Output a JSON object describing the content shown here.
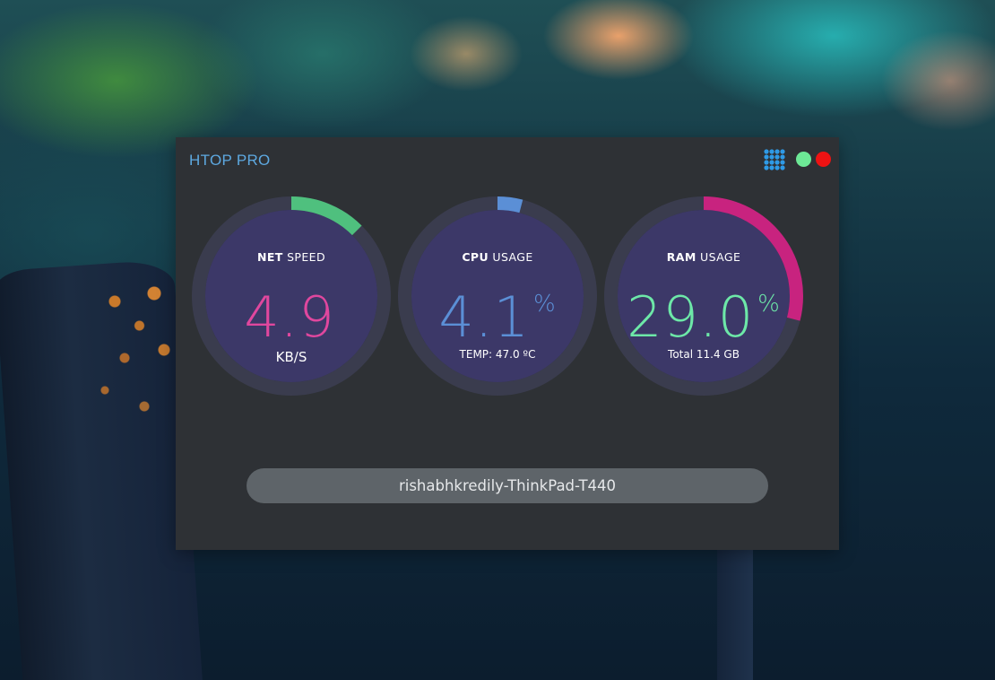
{
  "app": {
    "title": "HTOP PRO",
    "colors": {
      "window_bg": "#2e3135",
      "title": "#5da8e0",
      "gauge_track": "#3a3c4e",
      "gauge_face": "#3c3868",
      "menu_icon": "#2e9ae6",
      "green_button": "#6de896",
      "red_button": "#ee1313",
      "hostbar_bg": "#5e6469"
    },
    "icons": [
      "grid-menu-icon",
      "green-dot",
      "red-dot"
    ]
  },
  "gauges": {
    "net": {
      "label_bold": "NET",
      "label_rest": " SPEED",
      "value": "4.9",
      "unit": "",
      "sub": "KB/S",
      "arc_color": "#4fc07e",
      "value_color": "#e0479e",
      "fill_fraction": 0.125
    },
    "cpu": {
      "label_bold": "CPU",
      "label_rest": " USAGE",
      "value": "4.1",
      "unit": "%",
      "sub": "TEMP: 47.0 ºC",
      "arc_color": "#5b8fd6",
      "value_color": "#5b8fd6",
      "fill_fraction": 0.041
    },
    "ram": {
      "label_bold": "RAM",
      "label_rest": " USAGE",
      "value": "29.0",
      "unit": "%",
      "sub": "Total 11.4 GB",
      "arc_color": "#c8237f",
      "value_color": "#6de8a8",
      "fill_fraction": 0.29
    }
  },
  "hostname": "rishabhkredily-ThinkPad-T440"
}
